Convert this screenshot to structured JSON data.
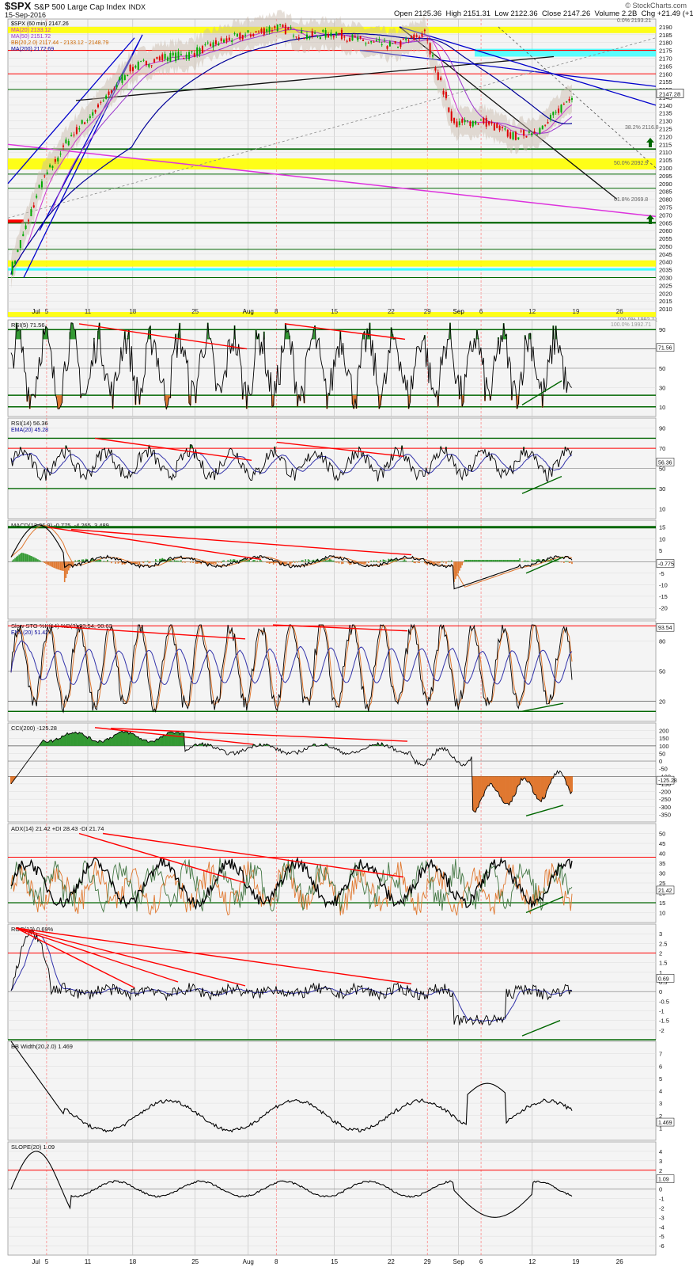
{
  "header": {
    "symbol": "$SPX",
    "name": "S&P 500 Large Cap Index",
    "exchange": "INDX",
    "date": "15-Sep-2016",
    "source": "© StockCharts.com",
    "quote": "Open 2125.36  High 2151.31  Low 2122.36  Close 2147.26  Volume 2.2B  Chg +21.49 (+1.01%)"
  },
  "price_legend": [
    {
      "text": "$SPX (60 min) 2147.26",
      "color": "#000000"
    },
    {
      "text": "MA(20) 2133.12",
      "color": "#cc33cc"
    },
    {
      "text": "MA(50) 2151.72",
      "color": "#9933cc"
    },
    {
      "text": "BB(20,2.0) 2117.44 - 2133.12 - 2148.79",
      "color": "#cc6600"
    },
    {
      "text": "MA(200) 2172.69",
      "color": "#000099"
    }
  ],
  "fib_labels": [
    "0.0% 2193.21",
    "38.2% 2116.8",
    "50.0% 2092.9",
    "61.8% 2069.8",
    "100.0% 1992.71"
  ],
  "x_ticks": [
    "Jul",
    "5",
    "11",
    "18",
    "25",
    "Aug",
    "8",
    "15",
    "22",
    "29",
    "Sep",
    "6",
    "12",
    "19",
    "26"
  ],
  "colors": {
    "up": "#00aa00",
    "down": "#dd0000",
    "green_line": "#006600",
    "red_line": "#ff0000",
    "yellow_zone": "#ffff00",
    "blue_trend": "#0000cc",
    "magenta_trend": "#dd33dd",
    "cyan_zone": "#33ffff"
  },
  "chart_data": [
    {
      "type": "candlestick",
      "panel": "price",
      "title": "$SPX (60 min) 2147.26",
      "ylim": [
        2005,
        2195
      ],
      "y_ticks": [
        2005,
        2010,
        2015,
        2020,
        2025,
        2030,
        2035,
        2040,
        2045,
        2050,
        2055,
        2060,
        2065,
        2070,
        2075,
        2080,
        2085,
        2090,
        2095,
        2100,
        2105,
        2110,
        2115,
        2120,
        2125,
        2130,
        2135,
        2140,
        2145,
        2150,
        2155,
        2160,
        2165,
        2170,
        2175,
        2180,
        2185,
        2190,
        2195
      ],
      "key_prices": {
        "last": 2147.28,
        "ma50": 2151.72,
        "ma20": 2133.12,
        "ma200": 2172.69
      },
      "series": [
        {
          "name": "$SPX",
          "x": [
            "Jul 1",
            "Jul 5",
            "Jul 8",
            "Jul 11",
            "Jul 15",
            "Jul 22",
            "Jul 29",
            "Aug 5",
            "Aug 12",
            "Aug 15",
            "Aug 19",
            "Aug 23",
            "Aug 29",
            "Sep 2",
            "Sep 7",
            "Sep 9",
            "Sep 12",
            "Sep 13",
            "Sep 14",
            "Sep 15"
          ],
          "values": [
            2035,
            2090,
            2120,
            2140,
            2163,
            2170,
            2172,
            2180,
            2185,
            2190,
            2184,
            2186,
            2180,
            2178,
            2186,
            2128,
            2130,
            2120,
            2125,
            2147
          ]
        }
      ]
    },
    {
      "type": "line",
      "panel": "rsi5",
      "title": "RSI(5) 71.56",
      "ylim": [
        0,
        100
      ],
      "y_ticks": [
        10,
        30,
        50,
        70,
        90
      ],
      "last": 71.56
    },
    {
      "type": "line",
      "panel": "rsi14",
      "title": "RSI(14) 56.36",
      "ylim": [
        0,
        100
      ],
      "y_ticks": [
        10,
        30,
        50,
        70,
        90
      ],
      "last": 56.36,
      "series": [
        {
          "name": "EMA(20) 45.28",
          "last": 45.28
        }
      ]
    },
    {
      "type": "line",
      "panel": "macd",
      "title": "MACD(12,26,9) -0.775, -4.265, 3.489",
      "ylim": [
        -25,
        18
      ],
      "y_ticks": [
        -20,
        -15,
        -10,
        -5,
        0,
        5,
        10,
        15
      ],
      "last": [
        -0.775,
        -4.265,
        3.489
      ]
    },
    {
      "type": "line",
      "panel": "slowsto",
      "title": "Slow STO %K(14) %D(3) 93.54, 90.63",
      "ylim": [
        0,
        100
      ],
      "y_ticks": [
        20,
        50,
        80
      ],
      "last": [
        93.54,
        90.63
      ],
      "series": [
        {
          "name": "EMA(20) 51.42",
          "last": 51.42
        }
      ]
    },
    {
      "type": "line",
      "panel": "cci",
      "title": "CCI(200) -125.28",
      "ylim": [
        -400,
        250
      ],
      "y_ticks": [
        -400,
        -350,
        -300,
        -250,
        -200,
        -150,
        -100,
        -50,
        0,
        50,
        100,
        150,
        200
      ],
      "last": -125.28
    },
    {
      "type": "line",
      "panel": "adx",
      "title": "ADX(14) 21.42 +DI 28.43 -DI 21.74",
      "ylim": [
        5,
        55
      ],
      "y_ticks": [
        10,
        15,
        20,
        25,
        30,
        35,
        40,
        45,
        50,
        55
      ],
      "last": [
        21.42,
        28.43,
        21.74
      ]
    },
    {
      "type": "line",
      "panel": "roc",
      "title": "ROC(12) 0.69%",
      "ylim": [
        -2.5,
        3.5
      ],
      "y_ticks": [
        -2.0,
        -1.5,
        -1.0,
        -0.5,
        0.0,
        0.5,
        1.0,
        1.5,
        2.0,
        2.5,
        3.0,
        3.5
      ],
      "last": 0.69
    },
    {
      "type": "line",
      "panel": "bbwidth",
      "title": "BB Width(20,2.0) 1.469",
      "ylim": [
        0,
        8
      ],
      "y_ticks": [
        1,
        2,
        3,
        4,
        5,
        6,
        7,
        8
      ],
      "last": 1.469
    },
    {
      "type": "line",
      "panel": "slope",
      "title": "SLOPE(20) 1.09",
      "ylim": [
        -7,
        5
      ],
      "y_ticks": [
        -6,
        -5,
        -4,
        -3,
        -2,
        -1,
        0,
        1,
        2,
        3,
        4,
        5
      ],
      "last": 1.09
    }
  ]
}
